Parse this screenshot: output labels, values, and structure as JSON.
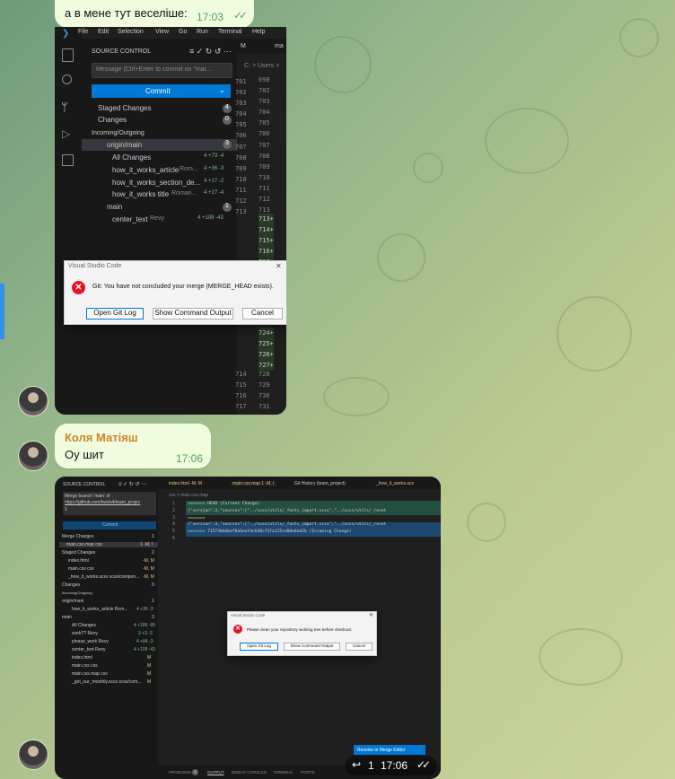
{
  "messages": {
    "m1": {
      "text": "а в мене тут веселіше:",
      "time": "17:03"
    },
    "m2": {
      "sender": "Коля Матіяш",
      "text": "Оу шит",
      "time": "17:06"
    },
    "m3": {
      "time": "17:06",
      "replies": "1"
    }
  },
  "shot1": {
    "menu": [
      "File",
      "Edit",
      "Selection",
      "View",
      "Go",
      "Run",
      "Terminal",
      "Help"
    ],
    "tab_label": "M",
    "tab_file": "ma",
    "breadcrumb": "C: > Users >",
    "source_control": "SOURCE CONTROL",
    "commit_placeholder": "Message (Ctrl+Enter to commit on \"mai...",
    "commit": "Commit",
    "staged": "Staged Changes",
    "staged_count": "4",
    "changes": "Changes",
    "changes_count": "0",
    "incoming": "Incoming/Outgoing",
    "origin": "origin/main",
    "origin_count": "3",
    "all_changes": "All Changes",
    "all_changes_stat": "4 +73 -4",
    "items": [
      {
        "name": "how_it_works_article",
        "author": "Rom...",
        "stat": "4 +36 -3"
      },
      {
        "name": "how_it_works_section_de...",
        "author": "",
        "stat": "4 +17 -2"
      },
      {
        "name": "how_it_works title",
        "author": "Roman...",
        "stat": "4 +27 -4"
      }
    ],
    "main": "main",
    "main_count": "1",
    "center_text": "center_text",
    "center_author": "Revy",
    "center_stat": "4 +109 -43",
    "lines_a": [
      "701",
      "702",
      "703",
      "704",
      "705",
      "706",
      "707",
      "708",
      "709",
      "710",
      "711",
      "712",
      "713"
    ],
    "lines_b": [
      "698",
      "702",
      "703",
      "704",
      "705",
      "706",
      "707",
      "708",
      "709",
      "710",
      "711",
      "712",
      "713"
    ],
    "lines_plus": [
      "713+",
      "714+",
      "715+",
      "716+",
      "717+"
    ],
    "lines_c_plus": [
      "724+",
      "725+",
      "726+",
      "727+"
    ],
    "lines_d": [
      "714",
      "715",
      "716",
      "717"
    ],
    "lines_e": [
      "728",
      "729",
      "730",
      "731"
    ],
    "dialog": {
      "title": "Visual Studio Code",
      "message": "Git: You have not concluded your merge (MERGE_HEAD exists).",
      "buttons": [
        "Open Git Log",
        "Show Command Output",
        "Cancel"
      ]
    }
  },
  "shot2": {
    "source_control": "SOURCE CONTROL",
    "merge_text": "Merge branch 'main' of",
    "merge_link": "https://github.com/lwoto4/team_projec",
    "merge_num": "1",
    "commit": "Commit",
    "tabs": [
      "index.html -M, M",
      "main.css.map 1 -M, I",
      "Git History (team_project)",
      "_how_it_works.scs"
    ],
    "breadcrumb": "css > main.css.map",
    "code": [
      "<<<<<<< HEAD (Current Change)",
      "{\"version\":3,\"sources\":[\"../scss/utils/_fonts_import.scss\",\"../scss/utils/_reset",
      "=======",
      "{\"version\":3,\"sources\":[\"../scss/utils/_fonts_import.scss\",\"../scss/utils/_reset",
      ">>>>>>> 7157304dbef8a6eefdc640cf2fa125ce80e6ad2b (Incoming Change)"
    ],
    "line_nums": [
      "1",
      "2",
      "3",
      "4",
      "5",
      "6"
    ],
    "tree": [
      {
        "t": "Merge Changes",
        "c": "1"
      },
      {
        "t": "main.css.map  css",
        "c": "1 -M, I"
      },
      {
        "t": "Staged Changes",
        "c": "2"
      },
      {
        "t": "index.html",
        "c": "-M, M"
      },
      {
        "t": "main.css  css",
        "c": "-M, M"
      },
      {
        "t": "_how_it_works.scss  scss/compon...",
        "c": "-M, M"
      },
      {
        "t": "Changes",
        "c": "0"
      },
      {
        "t": "Incoming/Outgoing",
        "c": ""
      },
      {
        "t": "origin/main",
        "c": "1"
      },
      {
        "t": "how_it_works_article  Rom...",
        "c": "4 +36 -3"
      },
      {
        "t": "main",
        "c": "3"
      },
      {
        "t": "All Changes",
        "c": "4 +186 -95"
      },
      {
        "t": "work??  Revy",
        "c": "3 +3 -3"
      },
      {
        "t": "please_work  Revy",
        "c": "4 +84 -3"
      },
      {
        "t": "center_text  Revy",
        "c": "4 +109 -43"
      },
      {
        "t": "index.html",
        "c": "M"
      },
      {
        "t": "main.css  css",
        "c": "M"
      },
      {
        "t": "main.css.map  css",
        "c": "M"
      },
      {
        "t": "_get_our_monthly.scss  scss/com...",
        "c": "M"
      }
    ],
    "dialog": {
      "title": "Visual Studio Code",
      "message": "Please clean your repository working tree before checkout.",
      "buttons": [
        "Open Git Log",
        "Show Command Output",
        "Cancel"
      ]
    },
    "resolve": "Resolve in Merge Editor",
    "panel_tabs": [
      "PROBLEMS",
      "OUTPUT",
      "DEBUG CONSOLE",
      "TERMINAL",
      "PORTS"
    ],
    "problems_count": "1"
  }
}
